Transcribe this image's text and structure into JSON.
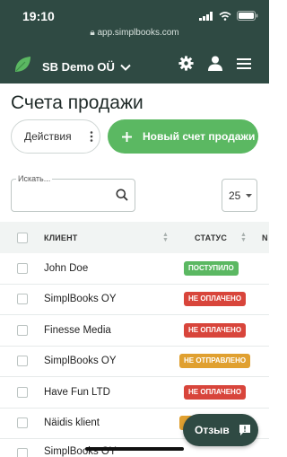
{
  "status_bar": {
    "time": "19:10"
  },
  "browser": {
    "url": "app.simplbooks.com"
  },
  "header": {
    "company": "SB Demo OÜ"
  },
  "page": {
    "title": "Счета продажи"
  },
  "toolbar": {
    "actions_label": "Действия",
    "new_label": "Новый счет продажи"
  },
  "filters": {
    "search_label": "Искать...",
    "per_page": "25"
  },
  "table": {
    "columns": {
      "client": "КЛИЕНТ",
      "status": "СТАТУС",
      "next": "N"
    },
    "rows": [
      {
        "client": "John Doe",
        "status": "ПОСТУПИЛО",
        "status_color": "#5bb862"
      },
      {
        "client": "SimplBooks OY",
        "status": "НЕ ОПЛАЧЕНО",
        "status_color": "#d8453b"
      },
      {
        "client": "Finesse Media",
        "status": "НЕ ОПЛАЧЕНО",
        "status_color": "#d8453b"
      },
      {
        "client": "SimplBooks OY",
        "status": "НЕ ОТПРАВЛЕНО",
        "status_color": "#e0a030"
      },
      {
        "client": "Have Fun LTD",
        "status": "НЕ ОПЛАЧЕНО",
        "status_color": "#d8453b"
      },
      {
        "client": "Näidis klient",
        "status": "",
        "status_color": "#e0a030"
      },
      {
        "client": "SimplBooks OY",
        "status": "",
        "status_color": ""
      }
    ]
  },
  "feedback": {
    "label": "Отзыв"
  },
  "colors": {
    "header": "#2f4a43",
    "accent": "#5bb862",
    "danger": "#d8453b",
    "warning": "#e0a030"
  }
}
